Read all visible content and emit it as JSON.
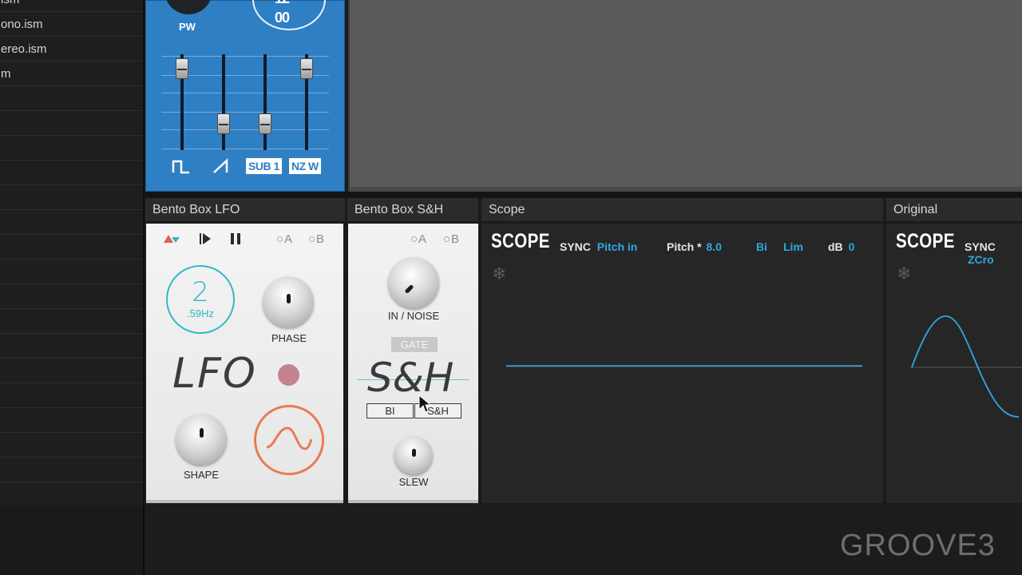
{
  "browser": {
    "items": [
      "ism",
      "ono.ism",
      "ereo.ism",
      "m",
      "",
      "",
      "",
      "",
      "",
      "",
      "",
      "",
      "",
      "",
      "",
      "",
      "",
      "",
      "",
      "",
      ""
    ]
  },
  "oscillator": {
    "pw_label": "PW",
    "ring_text_top": "12",
    "ring_text_bottom": "00",
    "sub_label": "SUB 1",
    "noise_label": "NZ W",
    "slider_levels": [
      0.95,
      0.2,
      0.2,
      0.95
    ]
  },
  "lfo": {
    "header": "Bento Box LFO",
    "rate_value": "2",
    "rate_unit": ".59Hz",
    "phase_label": "PHASE",
    "big_label": "LFO",
    "shape_label": "SHAPE",
    "a_label": "○A",
    "b_label": "○B"
  },
  "sh": {
    "header": "Bento Box S&H",
    "in_noise_label": "IN / NOISE",
    "gate_label": "GATE",
    "big_label": "S&H",
    "bi_label": "BI",
    "sh_label": "S&H",
    "slew_label": "SLEW",
    "a_label": "○A",
    "b_label": "○B"
  },
  "scope1": {
    "header": "Scope",
    "title": "SCOPE",
    "sync_key": "SYNC",
    "sync_val": "Pitch in",
    "pitch_key": "Pitch *",
    "pitch_val": "8.0",
    "bi": "Bi",
    "lim": "Lim",
    "db_key": "dB",
    "db_val": "0"
  },
  "scope2": {
    "header": "Original",
    "title": "SCOPE",
    "sync_key": "SYNC",
    "sync_val": "ZCro"
  },
  "watermark": "GROOVE3",
  "colors": {
    "accent_blue": "#2f7fc4",
    "teal": "#2fb8c6",
    "orange": "#e97b53",
    "scope_cyan": "#2ea8e0"
  }
}
